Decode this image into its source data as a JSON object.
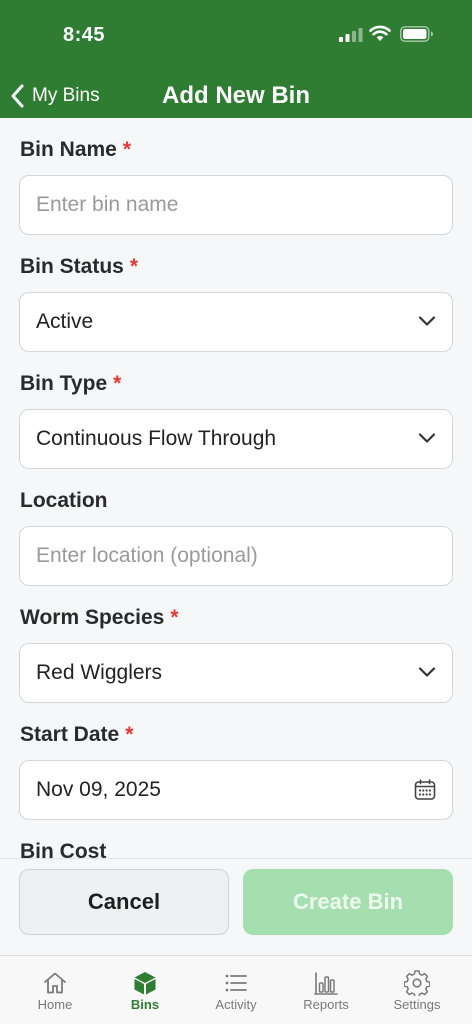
{
  "status_bar": {
    "time": "8:45"
  },
  "nav": {
    "back_label": "My Bins",
    "title": "Add New Bin"
  },
  "form": {
    "bin_name": {
      "label": "Bin Name",
      "required_mark": "*",
      "placeholder": "Enter bin name",
      "value": ""
    },
    "bin_status": {
      "label": "Bin Status",
      "required_mark": "*",
      "value": "Active"
    },
    "bin_type": {
      "label": "Bin Type",
      "required_mark": "*",
      "value": "Continuous Flow Through"
    },
    "location": {
      "label": "Location",
      "placeholder": "Enter location (optional)",
      "value": ""
    },
    "worm_species": {
      "label": "Worm Species",
      "required_mark": "*",
      "value": "Red Wigglers"
    },
    "start_date": {
      "label": "Start Date",
      "required_mark": "*",
      "value": "Nov 09, 2025"
    },
    "bin_cost": {
      "label": "Bin Cost"
    }
  },
  "actions": {
    "cancel_label": "Cancel",
    "create_label": "Create Bin"
  },
  "tabs": [
    {
      "label": "Home",
      "icon": "home-icon",
      "active": false
    },
    {
      "label": "Bins",
      "icon": "box-icon",
      "active": true
    },
    {
      "label": "Activity",
      "icon": "list-icon",
      "active": false
    },
    {
      "label": "Reports",
      "icon": "bar-chart-icon",
      "active": false
    },
    {
      "label": "Settings",
      "icon": "gear-icon",
      "active": false
    }
  ],
  "colors": {
    "brand": "#2e7d32",
    "required": "#e53935",
    "create_disabled": "#a5dfb0"
  }
}
